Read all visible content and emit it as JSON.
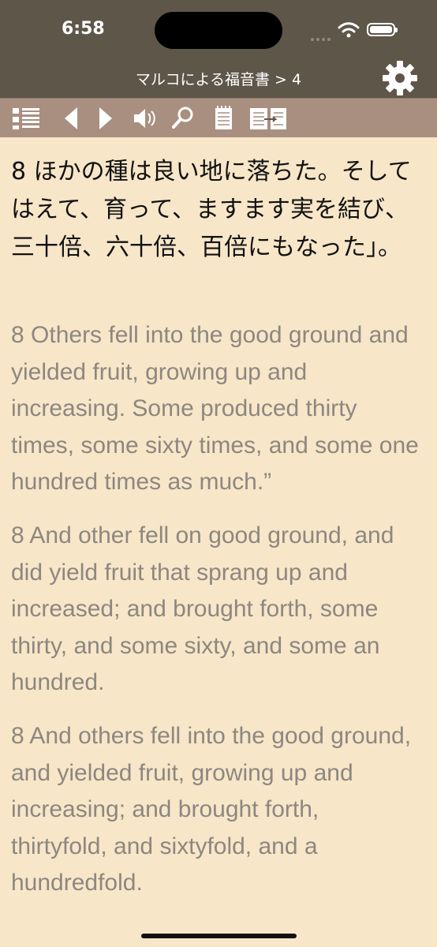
{
  "status_bar": {
    "time": "6:58"
  },
  "nav": {
    "title": "マルコによる福音書 > 4"
  },
  "toolbar": {
    "icons": [
      "list-icon",
      "previous-icon",
      "next-icon",
      "speaker-icon",
      "search-icon",
      "notes-icon",
      "compare-icon"
    ]
  },
  "verses": [
    {
      "number": "8",
      "text": "ほかの種は良い地に落ちた。そしてはえて、育って、ますます実を結び、三十倍、六十倍、百倍にもなった」。"
    },
    {
      "number": "8",
      "text": "Others fell into the good ground and yielded fruit, growing up and increasing. Some produced thirty times, some sixty times, and some one hundred times as much.”"
    },
    {
      "number": "8",
      "text": "And other fell on good ground, and did yield fruit that sprang up and increased; and brought forth, some thirty, and some sixty, and some an hundred."
    },
    {
      "number": "8",
      "text": "And others fell into the good ground, and yielded fruit, growing up and increasing; and brought forth, thirtyfold, and sixtyfold, and a hundredfold."
    }
  ],
  "colors": {
    "header": "#5e5649",
    "toolbar": "#a98f80",
    "background": "#f7e6c8",
    "primary_text": "#111111",
    "secondary_text": "#8d8780"
  }
}
